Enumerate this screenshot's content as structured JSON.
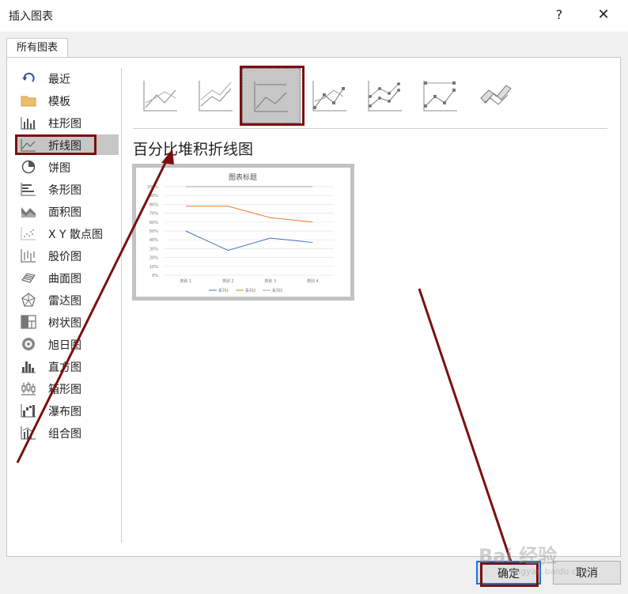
{
  "dialog": {
    "title": "插入图表",
    "help_label": "?",
    "close_label": "✕"
  },
  "tab": {
    "label": "所有图表"
  },
  "categories": [
    {
      "label": "最近",
      "icon": "recent-icon"
    },
    {
      "label": "模板",
      "icon": "folder-icon"
    },
    {
      "label": "柱形图",
      "icon": "column-chart-icon"
    },
    {
      "label": "折线图",
      "icon": "line-chart-icon",
      "selected": true
    },
    {
      "label": "饼图",
      "icon": "pie-chart-icon"
    },
    {
      "label": "条形图",
      "icon": "bar-chart-icon"
    },
    {
      "label": "面积图",
      "icon": "area-chart-icon"
    },
    {
      "label": "X Y 散点图",
      "icon": "scatter-chart-icon"
    },
    {
      "label": "股价图",
      "icon": "stock-chart-icon"
    },
    {
      "label": "曲面图",
      "icon": "surface-chart-icon"
    },
    {
      "label": "雷达图",
      "icon": "radar-chart-icon"
    },
    {
      "label": "树状图",
      "icon": "treemap-chart-icon"
    },
    {
      "label": "旭日图",
      "icon": "sunburst-chart-icon"
    },
    {
      "label": "直方图",
      "icon": "histogram-chart-icon"
    },
    {
      "label": "箱形图",
      "icon": "box-whisker-chart-icon"
    },
    {
      "label": "瀑布图",
      "icon": "waterfall-chart-icon"
    },
    {
      "label": "组合图",
      "icon": "combo-chart-icon"
    }
  ],
  "subtypes": [
    {
      "icon": "line-icon"
    },
    {
      "icon": "stacked-line-icon"
    },
    {
      "icon": "percent-stacked-line-icon",
      "selected": true
    },
    {
      "icon": "line-markers-icon"
    },
    {
      "icon": "stacked-line-markers-icon"
    },
    {
      "icon": "percent-stacked-line-markers-icon"
    },
    {
      "icon": "3d-line-icon"
    }
  ],
  "selected_subtype_name": "百分比堆积折线图",
  "preview": {
    "title": "图表标题",
    "y_ticks": [
      "100%",
      "90%",
      "80%",
      "70%",
      "60%",
      "50%",
      "40%",
      "30%",
      "20%",
      "10%",
      "0%"
    ],
    "categories": [
      "类别 1",
      "类别 2",
      "类别 3",
      "类别 4"
    ],
    "series": [
      {
        "name": "系列1",
        "color": "#4472c4",
        "values": [
          0.5,
          0.28,
          0.42,
          0.37
        ]
      },
      {
        "name": "系列2",
        "color": "#ed7d31",
        "values": [
          0.78,
          0.78,
          0.65,
          0.6
        ]
      },
      {
        "name": "系列3",
        "color": "#a5a5a5",
        "values": [
          1.0,
          1.0,
          1.0,
          1.0
        ]
      }
    ]
  },
  "buttons": {
    "ok": "确定",
    "cancel": "取消"
  },
  "watermark": {
    "text": "Bai 经验",
    "sub": "jingyan.baidu.com"
  }
}
